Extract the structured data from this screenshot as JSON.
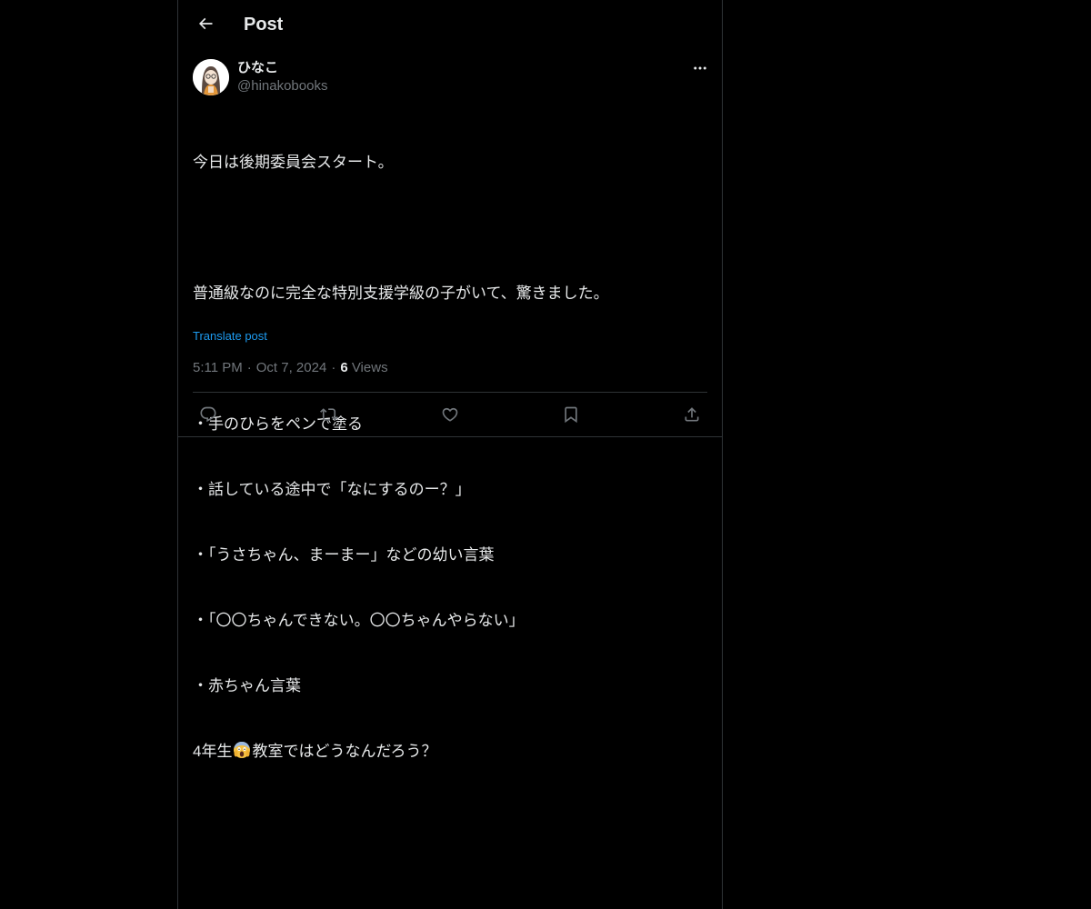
{
  "header": {
    "back_label": "←",
    "title": "Post"
  },
  "author": {
    "display_name": "ひなこ",
    "handle": "@hinakobooks"
  },
  "tweet": {
    "lines": [
      "今日は後期委員会スタート。",
      "",
      "普通級なのに完全な特別支援学級の子がいて、驚きました。",
      "",
      "・手のひらをペンで塗る",
      "・話している途中で「なにするのー？」",
      "・「うさちゃん、まーまー」などの幼い言葉",
      "・「〇〇ちゃんできない。〇〇ちゃんやらない」",
      "・赤ちゃん言葉"
    ],
    "last_line_before_emoji": "4年生",
    "emoji_name": "face-screaming-in-fear-emoji",
    "last_line_after_emoji": "教室ではどうなんだろう？",
    "translate_label": "Translate post"
  },
  "meta": {
    "time": "5:11 PM",
    "date": "Oct 7, 2024",
    "separator": "·",
    "views_count": "6",
    "views_label": "Views"
  },
  "actions": [
    "reply",
    "repost",
    "like",
    "bookmark",
    "share"
  ],
  "colors": {
    "background": "#000000",
    "text": "#e7e9ea",
    "secondary": "#71767b",
    "link": "#1d9bf0",
    "border": "#2f3336"
  }
}
